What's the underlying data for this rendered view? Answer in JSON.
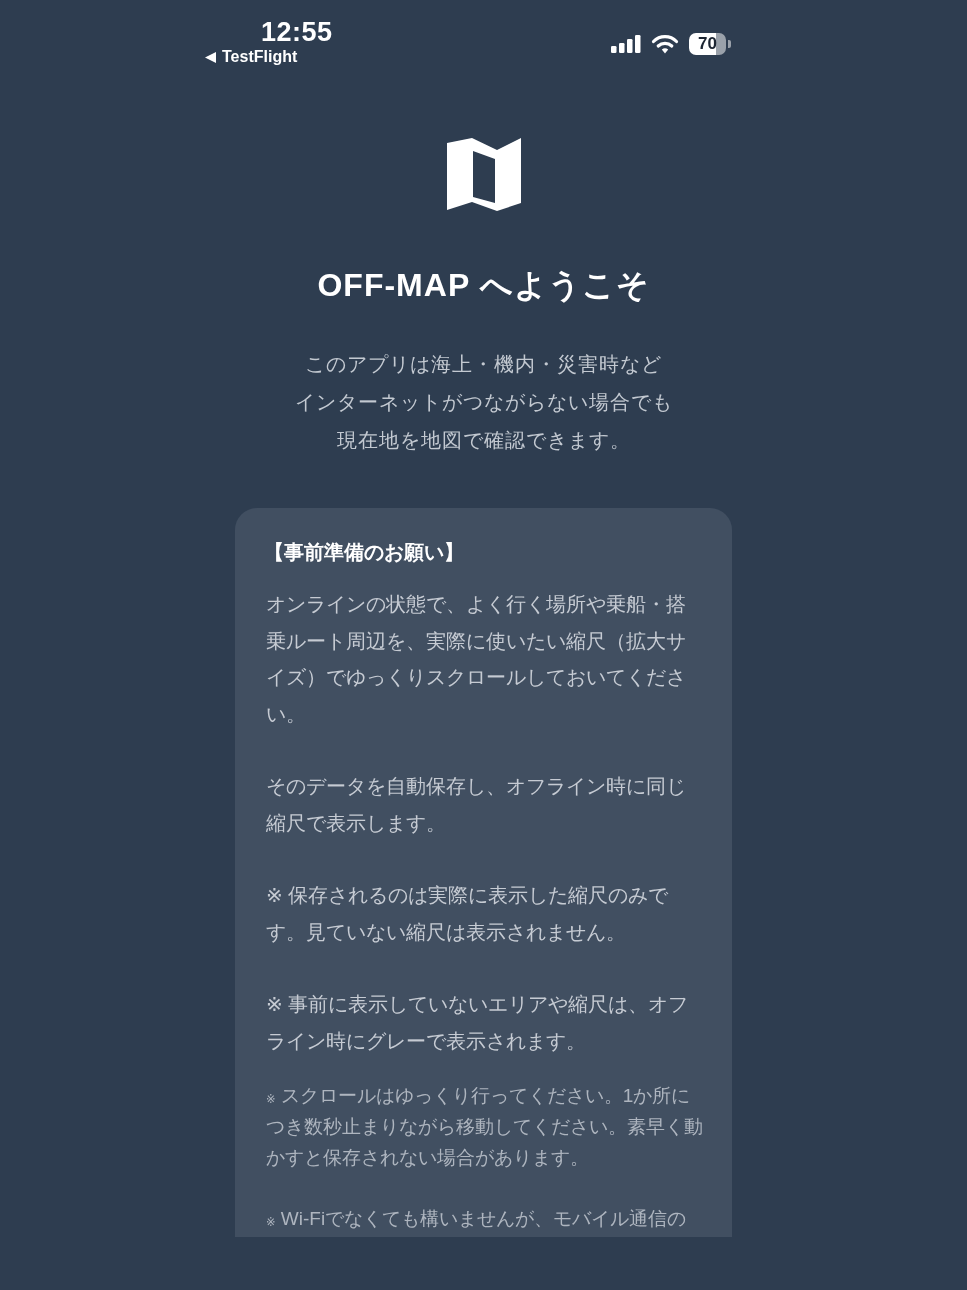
{
  "status_bar": {
    "time": "12:55",
    "back_label": "TestFlight",
    "battery": "70"
  },
  "welcome": {
    "title": "OFF-MAP へようこそ",
    "intro_lines": [
      "このアプリは海上・機内・災害時など",
      "インターネットがつながらない場合でも",
      "現在地を地図で確認できます。"
    ]
  },
  "notice_card": {
    "heading": "【事前準備のお願い】",
    "paragraphs": [
      {
        "kind": "body",
        "text": "オンラインの状態で、よく行く場所や乗船・搭乗ルート周辺を、実際に使いたい縮尺（拡大サイズ）でゆっくりスクロールしておいてください。"
      },
      {
        "kind": "body",
        "text": "そのデータを自動保存し、オフライン時に同じ縮尺で表示します。"
      },
      {
        "kind": "body",
        "text": "※ 保存されるのは実際に表示した縮尺のみです。見ていない縮尺は表示されません。"
      },
      {
        "kind": "body",
        "text": "※ 事前に表示していないエリアや縮尺は、オフライン時にグレーで表示されます。"
      },
      {
        "kind": "note",
        "text": "$_{※}$ スクロールはゆっくり行ってください。1か所につき数秒止まりながら移動してください。素早く動かすと保存されない場合があります。"
      },
      {
        "kind": "note",
        "text": "$_{※}$ Wi-Fiでなくても構いませんが、モバイル通信の"
      }
    ]
  }
}
